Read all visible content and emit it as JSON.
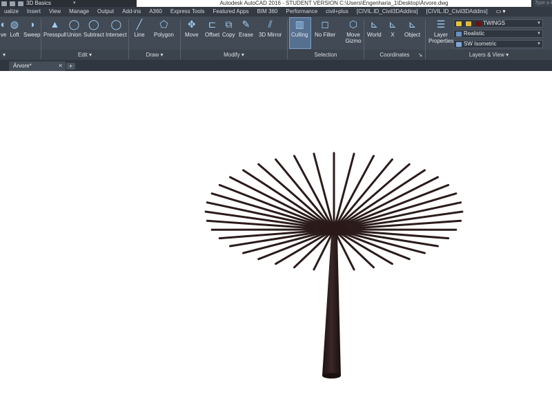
{
  "qat": {
    "workspace": "3D Basics"
  },
  "title": {
    "text": "Autodesk AutoCAD 2016 - STUDENT VERSION    C:\\Users\\Engenharia_1\\Desktop\\Árvore.dwg",
    "search_placeholder": "Type a k"
  },
  "menu_tabs": [
    "ualize",
    "Insert",
    "View",
    "Manage",
    "Output",
    "Add-ins",
    "A360",
    "Express Tools",
    "Featured Apps",
    "BIM 360",
    "Performance",
    "civil+plus",
    "[CIVIL.ID_Civil3DAddins]",
    "[CIVIL.ID_Civil3DAddins]",
    "▭ ▾"
  ],
  "tools": [
    {
      "label": "ve",
      "icon": "revolve-icon",
      "glyph": "◐"
    },
    {
      "label": "Loft",
      "icon": "loft-icon",
      "glyph": "◍"
    },
    {
      "label": "Sweep",
      "icon": "sweep-icon",
      "glyph": "◑"
    },
    {
      "label": "Presspull",
      "icon": "presspull-icon",
      "glyph": "▲"
    },
    {
      "label": "Union",
      "icon": "union-icon",
      "glyph": "◯"
    },
    {
      "label": "Subtract",
      "icon": "subtract-icon",
      "glyph": "◯"
    },
    {
      "label": "Intersect",
      "icon": "intersect-icon",
      "glyph": "◯"
    },
    {
      "label": "Line",
      "icon": "line-icon",
      "glyph": "╱"
    },
    {
      "label": "Polygon",
      "icon": "polygon-icon",
      "glyph": "⬠"
    },
    {
      "label": "Move",
      "icon": "move-icon",
      "glyph": "✥"
    },
    {
      "label": "Offset",
      "icon": "offset-icon",
      "glyph": "⊏"
    },
    {
      "label": "Copy",
      "icon": "copy-icon",
      "glyph": "⧉"
    },
    {
      "label": "Erase",
      "icon": "erase-icon",
      "glyph": "✎"
    },
    {
      "label": "3D Mirror",
      "icon": "mirror-3d-icon",
      "glyph": "⫽"
    },
    {
      "label": "Culling",
      "icon": "culling-icon",
      "glyph": "▥"
    },
    {
      "label": "No Filter",
      "icon": "filter-icon",
      "glyph": "◻"
    },
    {
      "label": "Move Gizmo",
      "icon": "gizmo-icon",
      "glyph": "⬡"
    },
    {
      "label": "World",
      "icon": "ucs-world-icon",
      "glyph": "⊾"
    },
    {
      "label": "X",
      "icon": "ucs-x-icon",
      "glyph": "⊾"
    },
    {
      "label": "Object",
      "icon": "ucs-object-icon",
      "glyph": "⊾"
    },
    {
      "label": "Layer Properties",
      "icon": "layer-properties-icon",
      "glyph": "☰"
    }
  ],
  "panels": [
    {
      "label": "▾"
    },
    {
      "label": "Edit ▾"
    },
    {
      "label": "Draw ▾"
    },
    {
      "label": "Modify ▾"
    },
    {
      "label": "Selection"
    },
    {
      "label": "Coordinates"
    },
    {
      "label": "Layers & View ▾"
    }
  ],
  "layers": {
    "layer_value": "TWINGS",
    "visual_style": "Realistic",
    "view": "SW Isometric",
    "dialog_launcher": "↘"
  },
  "file_tabs": {
    "active": "Árvore*",
    "close": "✕",
    "add": "+"
  },
  "colors": {
    "accent": "#56708f",
    "ribbon": "#414a55",
    "model": "#2b1b1b"
  },
  "model": {
    "spoke_count": 40
  }
}
